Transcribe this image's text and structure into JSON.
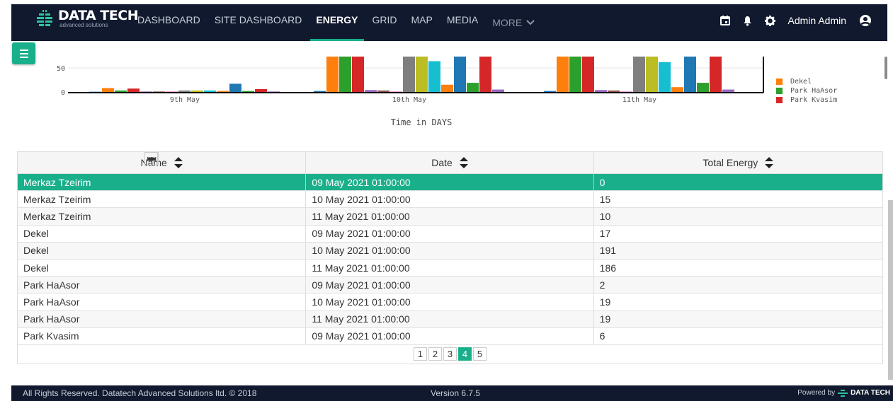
{
  "brand": {
    "name": "DATA TECH",
    "tagline": "advanced solutions"
  },
  "nav": {
    "items": [
      {
        "label": "DASHBOARD"
      },
      {
        "label": "SITE DASHBOARD"
      },
      {
        "label": "ENERGY",
        "active": true
      },
      {
        "label": "GRID"
      },
      {
        "label": "MAP"
      },
      {
        "label": "MEDIA"
      }
    ],
    "more_label": "MORE",
    "user_name": "Admin Admin",
    "icons": [
      "calendar-icon",
      "bell-icon",
      "gear-icon",
      "user-circle-icon"
    ]
  },
  "chart_data": {
    "type": "bar",
    "xlabel": "Time in DAYS",
    "y_ticks": [
      "0",
      "50"
    ],
    "categories": [
      "9th May",
      "10th May",
      "11th May"
    ],
    "series": [
      {
        "name": "Merkaz Tzeirim",
        "color": "#1f77b4",
        "values": [
          0,
          15,
          10
        ]
      },
      {
        "name": "Dekel",
        "color": "#ff7f0e",
        "values": [
          17,
          191,
          186
        ]
      },
      {
        "name": "Park HaAsor",
        "color": "#2ca02c",
        "values": [
          2,
          19,
          19
        ]
      },
      {
        "name": "Park Kvasim",
        "color": "#d62728",
        "values": [
          6,
          null,
          null
        ]
      }
    ],
    "visible_legend": [
      "Dekel",
      "Park HaAsor",
      "Park Kvasim"
    ],
    "legend_colors": [
      "#ff7f0e",
      "#2ca02c",
      "#d62728"
    ],
    "ylim_visible": [
      0,
      65
    ]
  },
  "table": {
    "headers": [
      "Name",
      "Date",
      "Total Energy"
    ],
    "rows": [
      {
        "name": "Merkaz Tzeirim",
        "date": "09 May 2021 01:00:00",
        "total": "0",
        "selected": true
      },
      {
        "name": "Merkaz Tzeirim",
        "date": "10 May 2021 01:00:00",
        "total": "15"
      },
      {
        "name": "Merkaz Tzeirim",
        "date": "11 May 2021 01:00:00",
        "total": "10"
      },
      {
        "name": "Dekel",
        "date": "09 May 2021 01:00:00",
        "total": "17"
      },
      {
        "name": "Dekel",
        "date": "10 May 2021 01:00:00",
        "total": "191"
      },
      {
        "name": "Dekel",
        "date": "11 May 2021 01:00:00",
        "total": "186"
      },
      {
        "name": "Park HaAsor",
        "date": "09 May 2021 01:00:00",
        "total": "2"
      },
      {
        "name": "Park HaAsor",
        "date": "10 May 2021 01:00:00",
        "total": "19"
      },
      {
        "name": "Park HaAsor",
        "date": "11 May 2021 01:00:00",
        "total": "19"
      },
      {
        "name": "Park Kvasim",
        "date": "09 May 2021 01:00:00",
        "total": "6"
      }
    ],
    "pages": [
      "1",
      "2",
      "3",
      "4",
      "5"
    ],
    "current_page": "4"
  },
  "footer": {
    "copyright": "All Rights Reserved. Datatech Advanced Solutions ltd. © 2018",
    "version": "Version 6.7.5",
    "powered_by": "Powered by",
    "powered_brand": "DATA TECH"
  },
  "colors": {
    "accent": "#1aaf8b",
    "navbar": "#10192e"
  }
}
